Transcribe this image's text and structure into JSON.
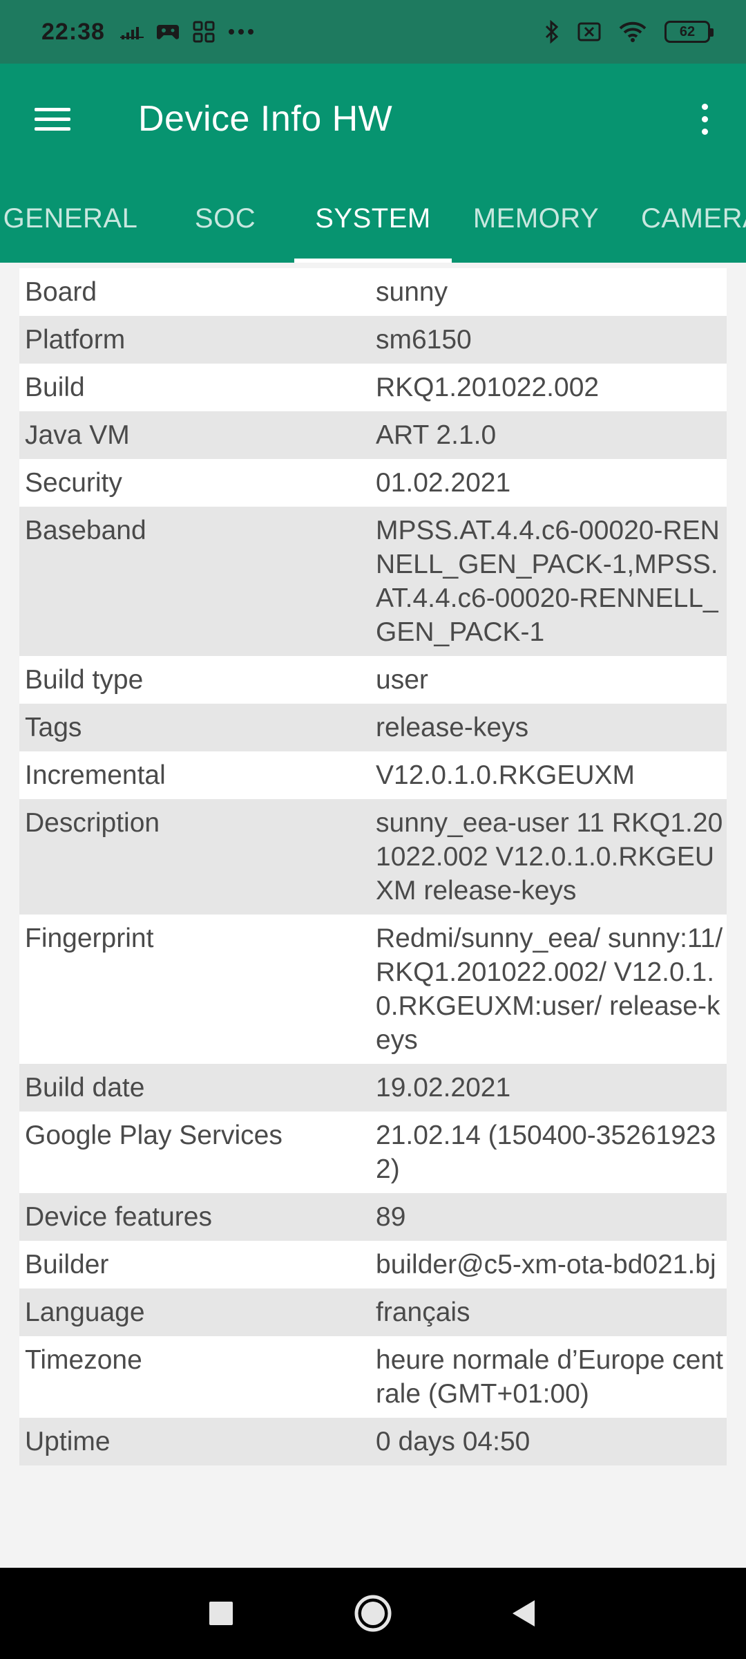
{
  "status_bar": {
    "time": "22:38",
    "left_icons": [
      "data-usage-icon",
      "gamepad-icon",
      "apps-grid-icon",
      "more-dots-icon"
    ],
    "right_icons": [
      "bluetooth-icon",
      "no-sim-icon",
      "wifi-icon",
      "battery-icon"
    ],
    "battery_level": "62"
  },
  "app_bar": {
    "title": "Device Info HW",
    "color": "#079470"
  },
  "tabs": [
    {
      "label": "GENERAL",
      "active": false
    },
    {
      "label": "SOC",
      "active": false
    },
    {
      "label": "SYSTEM",
      "active": true
    },
    {
      "label": "MEMORY",
      "active": false
    },
    {
      "label": "CAMERA",
      "active": false
    }
  ],
  "rows": [
    {
      "label": "Board",
      "value": "sunny"
    },
    {
      "label": "Platform",
      "value": "sm6150"
    },
    {
      "label": "Build",
      "value": "RKQ1.201022.002"
    },
    {
      "label": "Java VM",
      "value": "ART 2.1.0"
    },
    {
      "label": "Security",
      "value": "01.02.2021"
    },
    {
      "label": "Baseband",
      "value": "MPSS.AT.4.4.c6-00020-RENNELL_GEN_PACK-1,MPSS.AT.4.4.c6-00020-RENNELL_GEN_PACK-1"
    },
    {
      "label": "Build type",
      "value": "user"
    },
    {
      "label": "Tags",
      "value": "release-keys"
    },
    {
      "label": "Incremental",
      "value": "V12.0.1.0.RKGEUXM"
    },
    {
      "label": "Description",
      "value": "sunny_eea-user 11 RKQ1.201022.002 V12.0.1.0.RKGEUXM release-keys"
    },
    {
      "label": "Fingerprint",
      "value": "Redmi/sunny_eea/ sunny:11/ RKQ1.201022.002/ V12.0.1.0.RKGEUXM:user/ release-keys"
    },
    {
      "label": "Build date",
      "value": "19.02.2021"
    },
    {
      "label": "Google Play Services",
      "value": "21.02.14 (150400-352619232)"
    },
    {
      "label": "Device features",
      "value": "89"
    },
    {
      "label": "Builder",
      "value": "builder@c5-xm-ota-bd021.bj"
    },
    {
      "label": "Language",
      "value": "français"
    },
    {
      "label": "Timezone",
      "value": "heure normale d’Europe centrale (GMT+01:00)"
    },
    {
      "label": "Uptime",
      "value": "0 days 04:50"
    }
  ],
  "nav_bar": {
    "buttons": [
      "recents-square-icon",
      "home-circle-icon",
      "back-triangle-icon"
    ]
  }
}
